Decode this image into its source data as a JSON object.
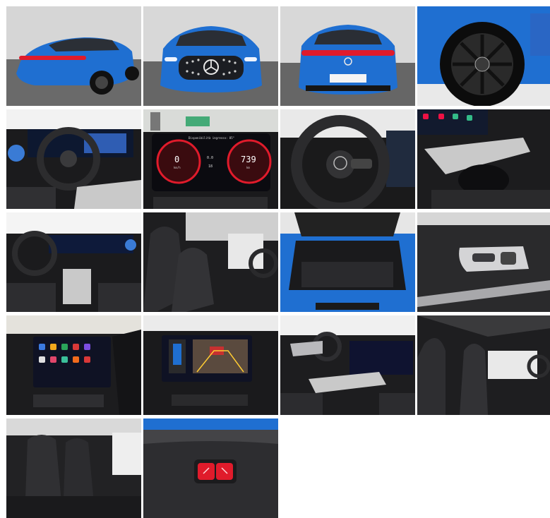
{
  "gallery": {
    "photos": [
      {
        "name": "exterior-rear-three-quarter"
      },
      {
        "name": "exterior-front"
      },
      {
        "name": "exterior-rear"
      },
      {
        "name": "wheel-closeup"
      },
      {
        "name": "dashboard-steering-wheel"
      },
      {
        "name": "instrument-cluster"
      },
      {
        "name": "steering-wheel-closeup"
      },
      {
        "name": "center-console"
      },
      {
        "name": "dashboard-wide"
      },
      {
        "name": "front-seats"
      },
      {
        "name": "trunk"
      },
      {
        "name": "door-panel-controls"
      },
      {
        "name": "infotainment-home-screen"
      },
      {
        "name": "infotainment-camera-view"
      },
      {
        "name": "cabin-side-view"
      },
      {
        "name": "front-seat-side"
      },
      {
        "name": "rear-seats"
      },
      {
        "name": "trunk-buttons"
      }
    ]
  },
  "cluster": {
    "left_value": "0",
    "right_value": "739",
    "header": "Disponibilità ingresso: 85°",
    "left_unit": "km/h",
    "right_unit": "km",
    "mid_top": "0.0",
    "mid_bottom": "18"
  },
  "colors": {
    "car_blue": "#1f6fd1",
    "garage_floor": "#6b6b6b",
    "garage_wall": "#d8d8d8",
    "cabin_dark": "#1b1b1d",
    "trim_silver": "#c9c9c9",
    "red_light": "#e01b2b",
    "screen_blue": "#1a3a8a"
  }
}
